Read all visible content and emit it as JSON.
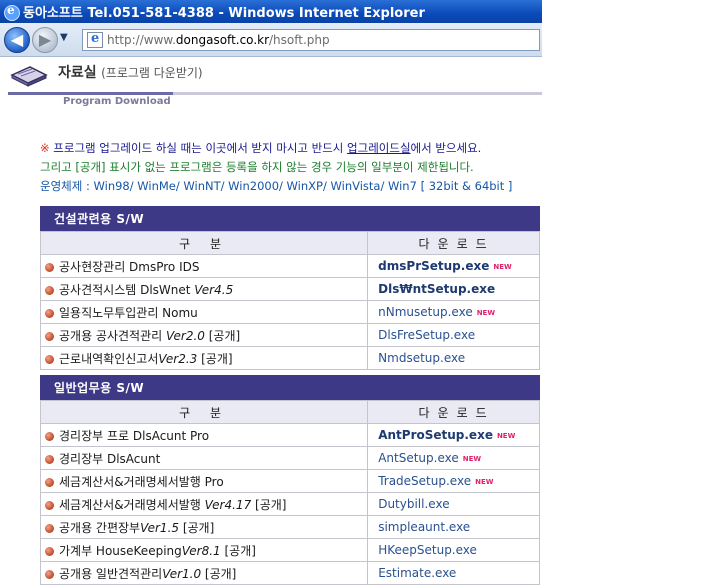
{
  "window": {
    "title": "동아소프트 Tel.051-581-4388 - Windows Internet Explorer"
  },
  "nav": {
    "back_glyph": "◀",
    "forward_glyph": "▶",
    "dropdown_glyph": "▼",
    "address_prefix": "http://www.",
    "address_host": "dongasoft.co.kr",
    "address_path": "/hsoft.php"
  },
  "header": {
    "title": "자료실",
    "subtitle_kr": "(프로그램 다운받기)",
    "subtitle_en": "Program Download"
  },
  "notice": {
    "mark": "※",
    "line1_a": " 프로그램 업그레이드 하실 때는 이곳에서 받지 마시고 반드시 ",
    "line1_link": "업그레이드실",
    "line1_b": "에서 받으세요.",
    "line2": "그리고 [공개] 표시가 없는 프로그램은 등록을 하지 않는 경우 기능의 일부분이 제한됩니다.",
    "line3": "운영체제 : Win98/ WinMe/ WinNT/ Win2000/ WinXP/ WinVista/ Win7 [ 32bit & 64bit ]"
  },
  "badge_new": "NEW",
  "sections": [
    {
      "title": "건설관련용 S/W",
      "col_program": "구 분",
      "col_download": "다운로드",
      "rows": [
        {
          "name": "공사현장관리 DmsPro IDS",
          "version": "",
          "suffix": "",
          "file": "dmsPrSetup.exe",
          "bold": true,
          "is_new": true
        },
        {
          "name": "공사견적시스템 DlsWnet ",
          "version": "Ver4.5",
          "suffix": "",
          "file": "Dls₩ntSetup.exe",
          "bold": true,
          "is_new": false
        },
        {
          "name": "일용직노무투입관리 Nomu",
          "version": "",
          "suffix": "",
          "file": "nNmusetup.exe",
          "bold": false,
          "is_new": true
        },
        {
          "name": "공개용 공사견적관리 ",
          "version": "Ver2.0",
          "suffix": " [공개]",
          "file": "DlsFreSetup.exe",
          "bold": false,
          "is_new": false
        },
        {
          "name": "근로내역확인신고서",
          "version": "Ver2.3",
          "suffix": " [공개]",
          "file": "Nmdsetup.exe",
          "bold": false,
          "is_new": false
        }
      ]
    },
    {
      "title": "일반업무용 S/W",
      "col_program": "구 분",
      "col_download": "다운로드",
      "rows": [
        {
          "name": "경리장부 프로 DlsAcunt Pro",
          "version": "",
          "suffix": "",
          "file": "AntProSetup.exe",
          "bold": true,
          "is_new": true
        },
        {
          "name": "경리장부 DlsAcunt",
          "version": "",
          "suffix": "",
          "file": "AntSetup.exe",
          "bold": false,
          "is_new": true
        },
        {
          "name": "세금계산서&거래명세서발행 Pro",
          "version": "",
          "suffix": "",
          "file": "TradeSetup.exe",
          "bold": false,
          "is_new": true
        },
        {
          "name": "세금계산서&거래명세서발행 ",
          "version": "Ver4.17",
          "suffix": " [공개]",
          "file": "Dutybill.exe",
          "bold": false,
          "is_new": false
        },
        {
          "name": "공개용 간편장부",
          "version": "Ver1.5",
          "suffix": " [공개]",
          "file": "simpleaunt.exe",
          "bold": false,
          "is_new": false
        },
        {
          "name": "가계부 HouseKeeping",
          "version": "Ver8.1",
          "suffix": " [공개]",
          "file": "HKeepSetup.exe",
          "bold": false,
          "is_new": false
        },
        {
          "name": "공개용 일반견적관리",
          "version": "Ver1.0",
          "suffix": " [공개]",
          "file": "Estimate.exe",
          "bold": false,
          "is_new": false
        }
      ]
    }
  ]
}
